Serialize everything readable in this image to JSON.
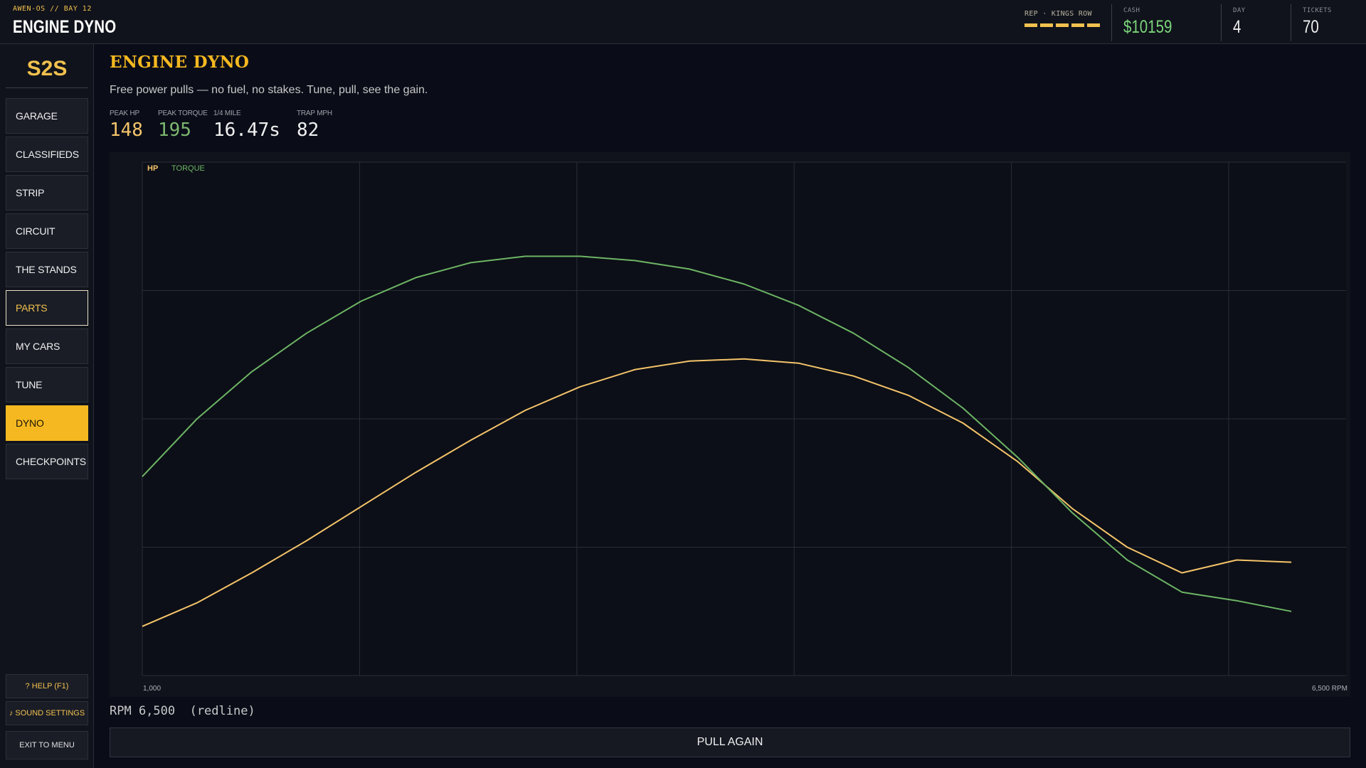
{
  "topbar": {
    "subtitle": "AWEN-OS // BAY 12",
    "title": "ENGINE DYNO",
    "rep_label": "REP · KINGS ROW",
    "rep_bars_filled": 5,
    "cash_label": "CASH",
    "cash_value": "$10159",
    "day_label": "DAY",
    "day_value": "4",
    "tickets_label": "TICKETS",
    "tickets_value": "70"
  },
  "sidebar": {
    "logo": "S2S",
    "items": [
      {
        "label": "GARAGE",
        "state": "normal"
      },
      {
        "label": "CLASSIFIEDS",
        "state": "normal"
      },
      {
        "label": "STRIP",
        "state": "normal"
      },
      {
        "label": "CIRCUIT",
        "state": "normal"
      },
      {
        "label": "THE STANDS",
        "state": "normal"
      },
      {
        "label": "PARTS",
        "state": "outlined"
      },
      {
        "label": "MY CARS",
        "state": "normal"
      },
      {
        "label": "TUNE",
        "state": "normal"
      },
      {
        "label": "DYNO",
        "state": "active"
      },
      {
        "label": "CHECKPOINTS",
        "state": "normal"
      }
    ],
    "help_label": "? HELP (F1)",
    "sound_label": "♪ SOUND SETTINGS",
    "exit_label": "EXIT TO MENU"
  },
  "main": {
    "title": "ENGINE DYNO",
    "subtitle": "Free power pulls — no fuel, no stakes. Tune, pull, see the gain.",
    "metrics": [
      {
        "label": "PEAK HP",
        "value": "148",
        "color": "#f5c46a"
      },
      {
        "label": "PEAK TORQUE",
        "value": "195",
        "color": "#7cb66f"
      },
      {
        "label": "1/4 MILE",
        "value": "16.47s",
        "color": "#f0f0f0"
      },
      {
        "label": "TRAP MPH",
        "value": "82",
        "color": "#f0f0f0"
      }
    ],
    "rpm_readout": "RPM 6,500  (redline)",
    "pull_button": "PULL AGAIN"
  },
  "chart_data": {
    "type": "line",
    "title": "",
    "xlabel": "RPM",
    "x_tick_labels": [
      "1,000",
      "6,500 RPM"
    ],
    "xlim": [
      1000,
      6500
    ],
    "ylim": [
      0,
      240
    ],
    "grid": true,
    "legend": "top-left",
    "x": [
      1000,
      1250,
      1500,
      1750,
      2000,
      2250,
      2500,
      2750,
      3000,
      3250,
      3500,
      3750,
      4000,
      4250,
      4500,
      4750,
      5000,
      5250,
      5500,
      5750,
      6000,
      6250,
      6350,
      6425,
      6500
    ],
    "series": [
      {
        "name": "HP",
        "color": "#f5c46a",
        "values": [
          23,
          34,
          48,
          63,
          79,
          95,
          110,
          124,
          135,
          143,
          147,
          148,
          146,
          140,
          131,
          118,
          100,
          78,
          60,
          48,
          54,
          53
        ]
      },
      {
        "name": "TORQUE",
        "color": "#6db565",
        "values": [
          93,
          120,
          142,
          160,
          175,
          186,
          193,
          196,
          196,
          194,
          190,
          183,
          173,
          160,
          144,
          125,
          102,
          76,
          54,
          39,
          35,
          30
        ]
      }
    ]
  }
}
